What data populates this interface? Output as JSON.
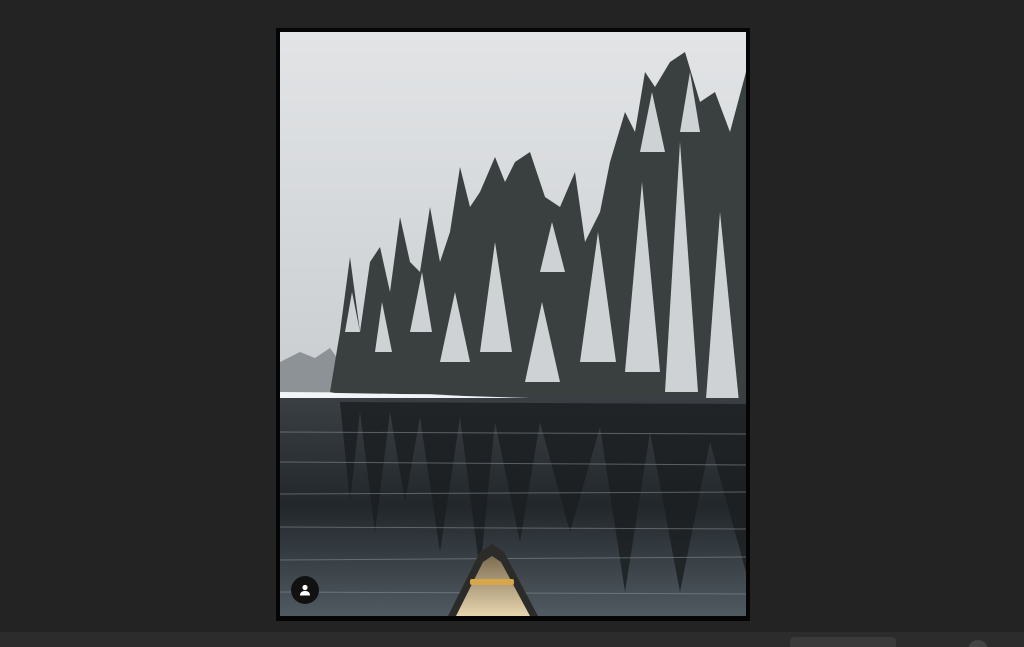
{
  "viewer": {
    "background_color": "#232323",
    "frame_color": "#050505"
  },
  "photo": {
    "subject_icon": "winter-lake-canoe-photo"
  },
  "user_badge": {
    "icon": "user-icon"
  }
}
